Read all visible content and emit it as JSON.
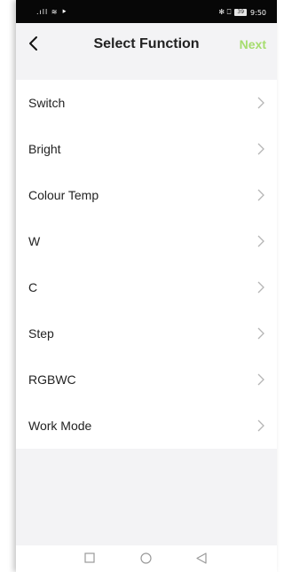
{
  "status_bar": {
    "left_icons": ".ıll ≋ ⯈",
    "right_icons": "✻ ⎕",
    "battery": "39",
    "time": "9:50"
  },
  "header": {
    "title": "Select Function",
    "next_label": "Next",
    "next_color": "#a6dd6e"
  },
  "functions": [
    {
      "label": "Switch"
    },
    {
      "label": "Bright"
    },
    {
      "label": "Colour Temp"
    },
    {
      "label": "W"
    },
    {
      "label": "C"
    },
    {
      "label": "Step"
    },
    {
      "label": "RGBWC"
    },
    {
      "label": "Work Mode"
    }
  ],
  "icons": {
    "back": "chevron-left-icon",
    "row": "chevron-right-icon",
    "nav": [
      "square-icon",
      "circle-icon",
      "triangle-icon"
    ]
  }
}
